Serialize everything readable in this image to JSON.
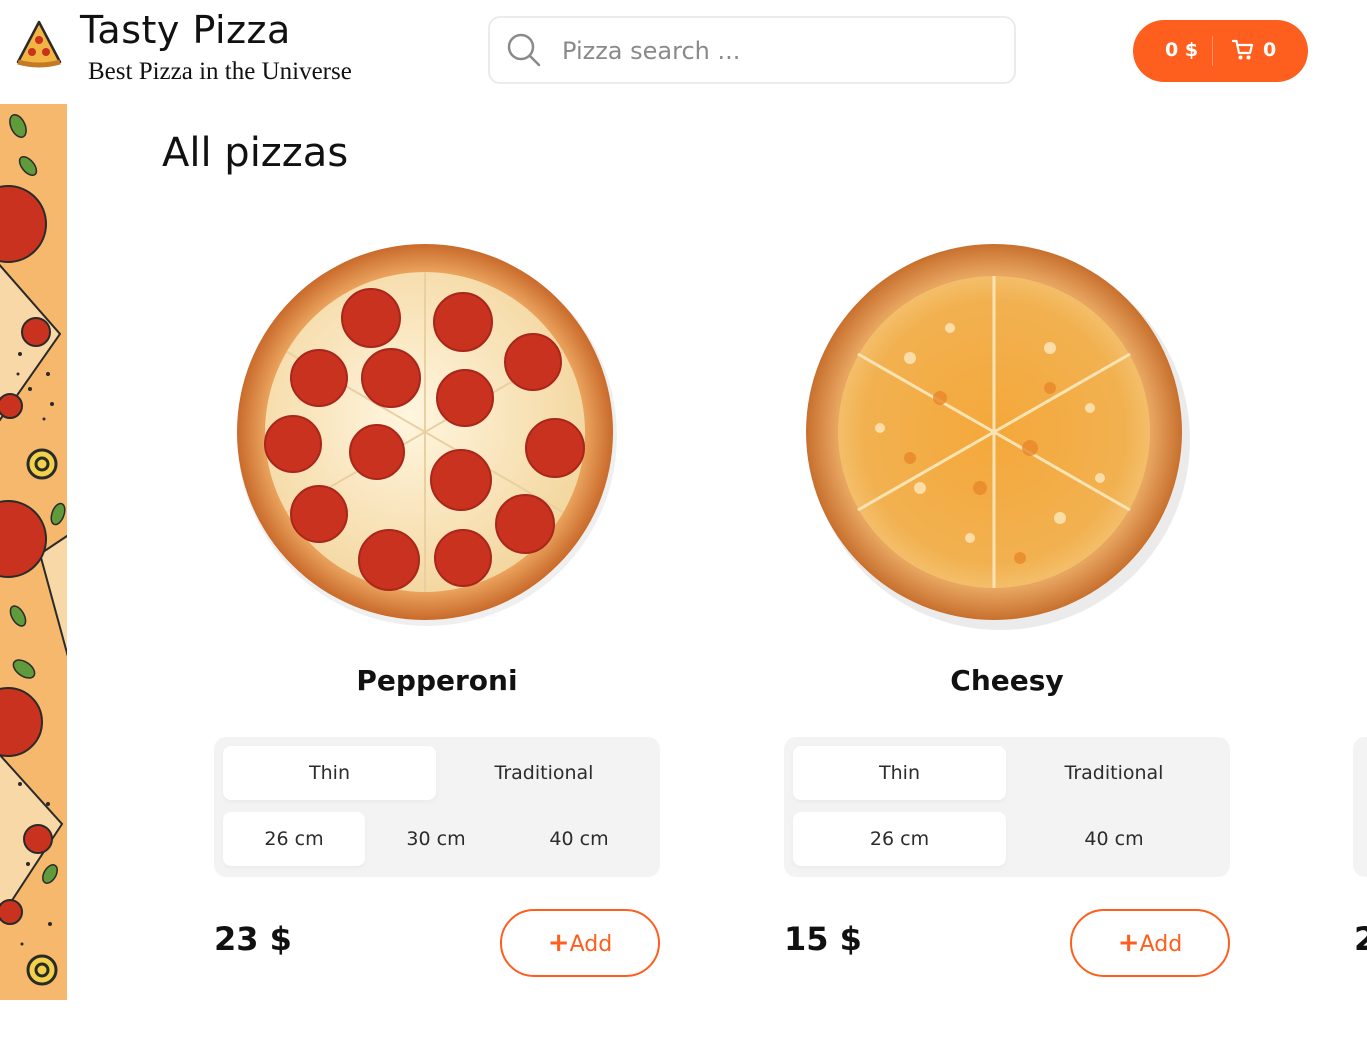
{
  "header": {
    "brand_title": "Tasty Pizza",
    "brand_subtitle": "Best Pizza in the Universe",
    "search": {
      "placeholder": "Pizza search ...",
      "value": ""
    },
    "cart": {
      "total": "0 $",
      "count": "0"
    }
  },
  "main": {
    "title": "All pizzas",
    "pizzas": [
      {
        "name": "Pepperoni",
        "types": [
          "Thin",
          "Traditional"
        ],
        "active_type": "Thin",
        "sizes": [
          "26 cm",
          "30 cm",
          "40 cm"
        ],
        "active_size": "26 cm",
        "price": "23 $",
        "add_label": "Add"
      },
      {
        "name": "Cheesy",
        "types": [
          "Thin",
          "Traditional"
        ],
        "active_type": "Thin",
        "sizes": [
          "26 cm",
          "40 cm"
        ],
        "active_size": "26 cm",
        "price": "15 $",
        "add_label": "Add"
      }
    ],
    "partial_card_price": "2"
  },
  "colors": {
    "accent": "#fe5f1e",
    "selector_bg": "#f3f3f3",
    "strip_bg": "#f6b86c",
    "pepperoni": "#c8321f",
    "cheese": "#f2a43a"
  },
  "icons": {
    "logo": "pizza-slice-icon",
    "search": "search-icon",
    "cart": "cart-icon",
    "add": "plus-icon"
  }
}
